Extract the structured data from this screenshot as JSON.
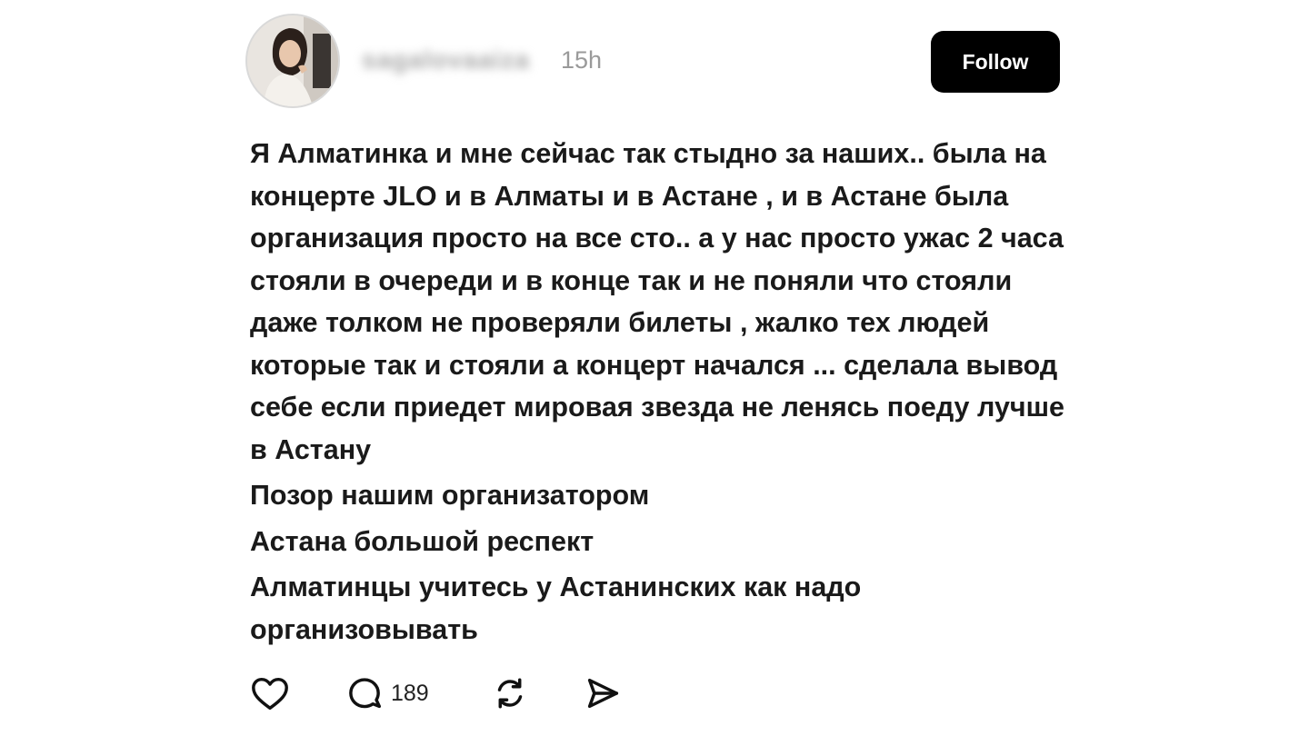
{
  "post": {
    "username": "sagalovaaiza",
    "timestamp": "15h",
    "follow_label": "Follow",
    "paragraphs": [
      "Я Алматинка и мне сейчас так стыдно за наших.. была на концерте JLO и в Алматы и в Астане , и в Астане была организация просто на все сто.. а у нас просто ужас 2 часа стояли в очереди и в конце так и не поняли что стояли даже толком не проверяли билеты , жалко тех людей которые так и стояли а концерт начался ... сделала вывод себе если приедет мировая звезда не ленясь поеду лучше в Астану",
      "Позор нашим организатором",
      "Астана большой респект",
      "Алматинцы учитесь у Астанинских как надо организовывать"
    ]
  },
  "actions": {
    "like_icon": "heart-icon",
    "comment_icon": "speech-bubble-icon",
    "comment_count": "189",
    "repost_icon": "repost-arrows-icon",
    "share_icon": "paper-plane-icon"
  }
}
